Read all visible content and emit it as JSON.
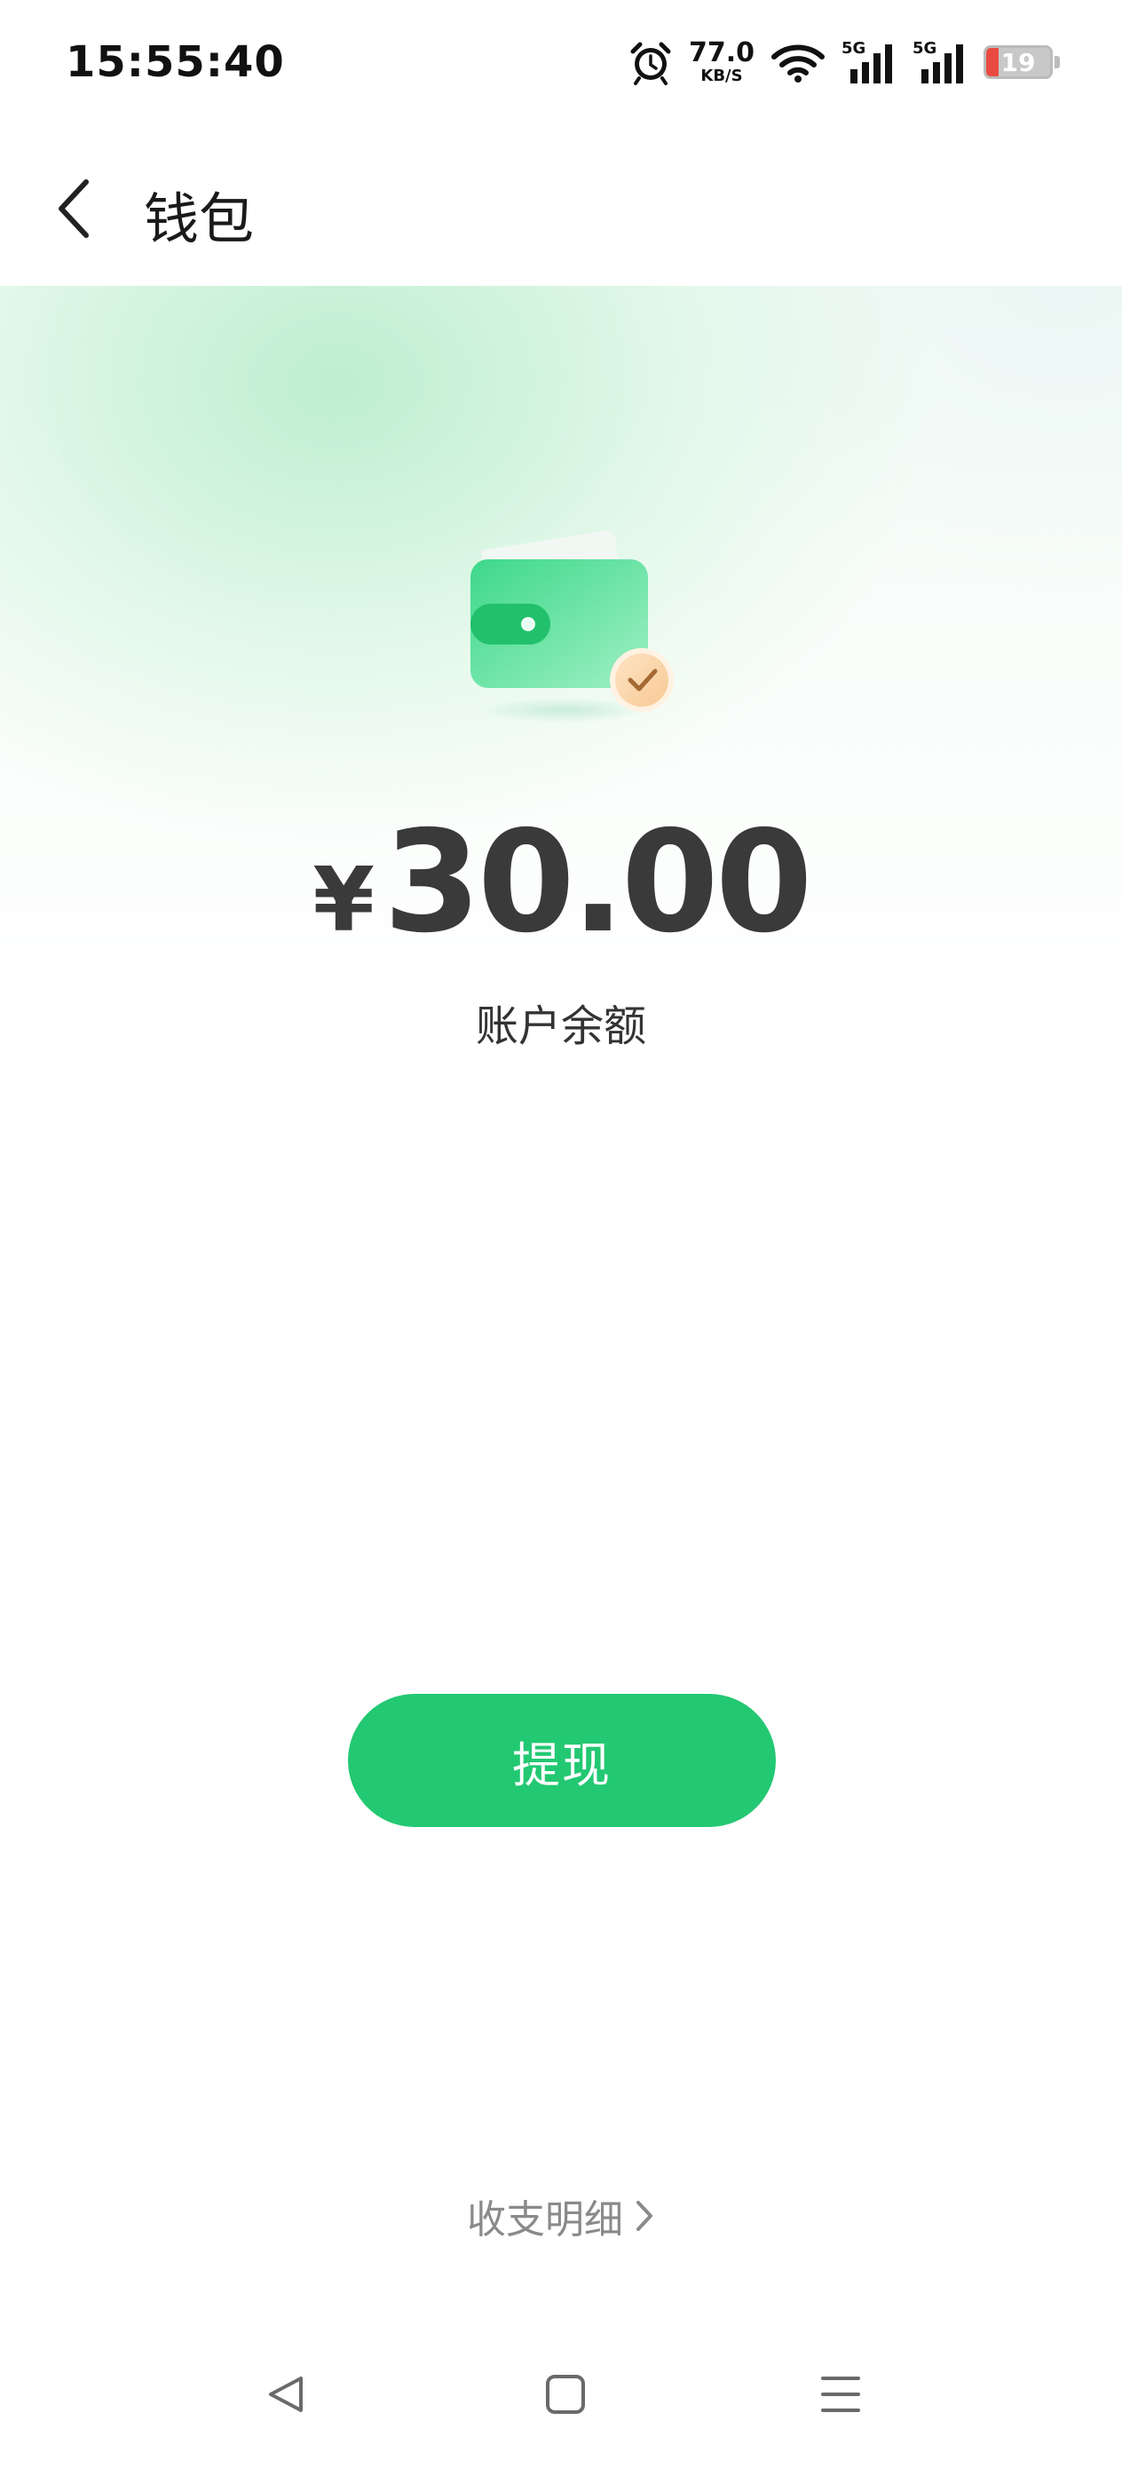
{
  "status_bar": {
    "time": "15:55:40",
    "net_speed_value": "77.0",
    "net_speed_unit": "KB/S",
    "sim1_label": "5G",
    "sim2_label": "5G",
    "battery_level": "19",
    "battery_color": "#e94b43",
    "icons": [
      "alarm-icon",
      "wifi-icon",
      "signal-icon",
      "signal-icon",
      "battery-icon"
    ]
  },
  "nav": {
    "title": "钱包",
    "back_icon": "chevron-left-icon"
  },
  "wallet": {
    "icon": "wallet-check-icon",
    "currency_symbol": "¥",
    "balance": "30.00",
    "balance_label": "账户余额",
    "accent_color": "#23c872"
  },
  "actions": {
    "withdraw_label": "提现",
    "detail_label": "收支明细"
  },
  "system_nav": {
    "back_icon": "triangle-back-icon",
    "home_icon": "square-home-icon",
    "menu_icon": "menu-lines-icon"
  }
}
